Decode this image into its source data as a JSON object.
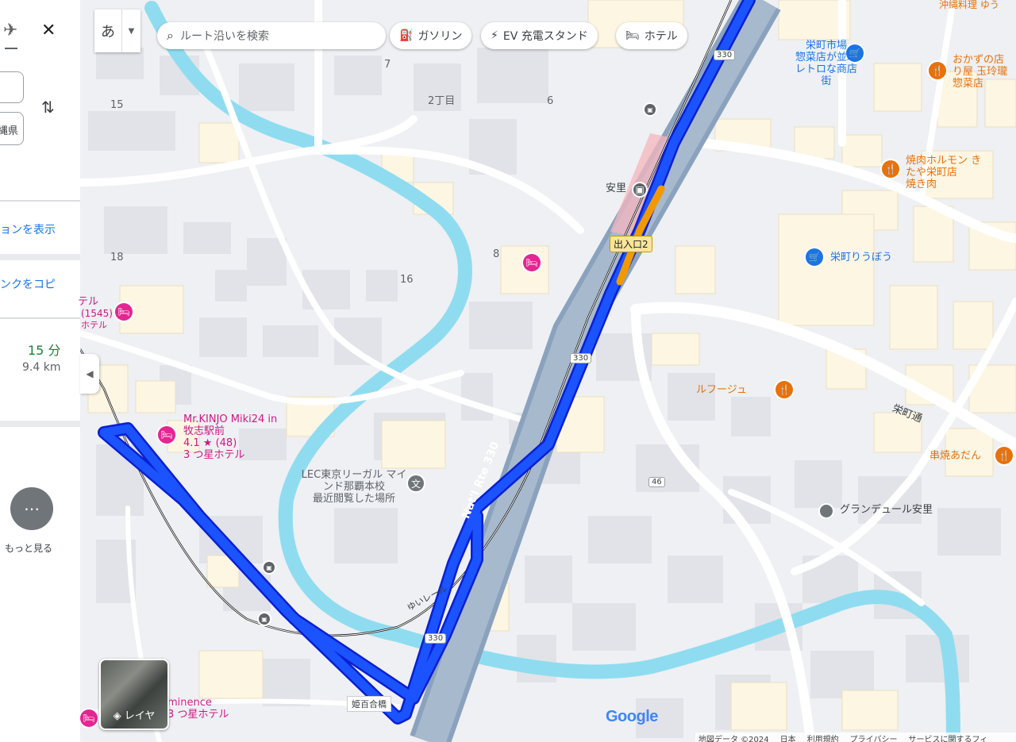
{
  "panel": {
    "close_icon": "close-icon",
    "mode_icon": "airplane-icon",
    "input_fragment": "縄県",
    "show_directions_link": "ョンを表示",
    "copy_link": "ンクをコピ",
    "hotel_fragment_1": "テル",
    "hotel_fragment_2": "(1545)",
    "hotel_fragment_3": "ホテル",
    "duration": "15 分",
    "distance": "9.4 km",
    "more_label": "もっと見る"
  },
  "toolbar": {
    "ime_label": "あ",
    "search_placeholder": "ルート沿いを検索",
    "chips": [
      "ガソリン",
      "EV 充電スタンド",
      "ホテル"
    ]
  },
  "map": {
    "block_numbers": [
      "7",
      "2丁目",
      "6",
      "15",
      "18",
      "16",
      "8"
    ],
    "route_shields": [
      "330",
      "330",
      "330",
      "46"
    ],
    "road_name": "Nat'l Rte 330",
    "street_name": "栄町通",
    "station_name": "安里",
    "exit_label": "出入口2",
    "rail_label": "ゆいレール",
    "bridge_label": "姫百合橋",
    "places": [
      {
        "name": "栄町市場",
        "sub": "惣菜店が並ぶ レトロな商店街"
      },
      {
        "name": "おかずの店 り屋 玉玲瓏",
        "sub": "惣菜店"
      },
      {
        "name": "焼肉ホルモン きたや栄町店",
        "sub": "焼き肉"
      },
      {
        "name": "栄町りうぼう"
      },
      {
        "name": "ルフージュ"
      },
      {
        "name": "串焼あだん"
      },
      {
        "name": "グランデュール安里"
      },
      {
        "name": "Mr.KINJO Miki24 in 牧志駅前",
        "sub": "4.1 ★ (48)",
        "sub2": "3 つ星ホテル"
      },
      {
        "name": "LEC東京リーガル マインド那覇本校",
        "sub": "最近閲覧した場所"
      },
      {
        "name": "沖縄料理 ゆう"
      },
      {
        "name": "minence",
        "sub": "3 つ星ホテル"
      }
    ],
    "layer_label": "レイヤ",
    "google_logo": "Google",
    "footer": [
      "地図データ ©2024",
      "日本",
      "利用規約",
      "プライバシー",
      "サービスに関するフィ"
    ],
    "colors": {
      "route": "#1a53ff",
      "route_border": "#0b1fd1",
      "traffic_slow": "#f29900",
      "water": "#8fdcf0",
      "road": "#ffffff",
      "highway": "#8aa2bd"
    }
  }
}
